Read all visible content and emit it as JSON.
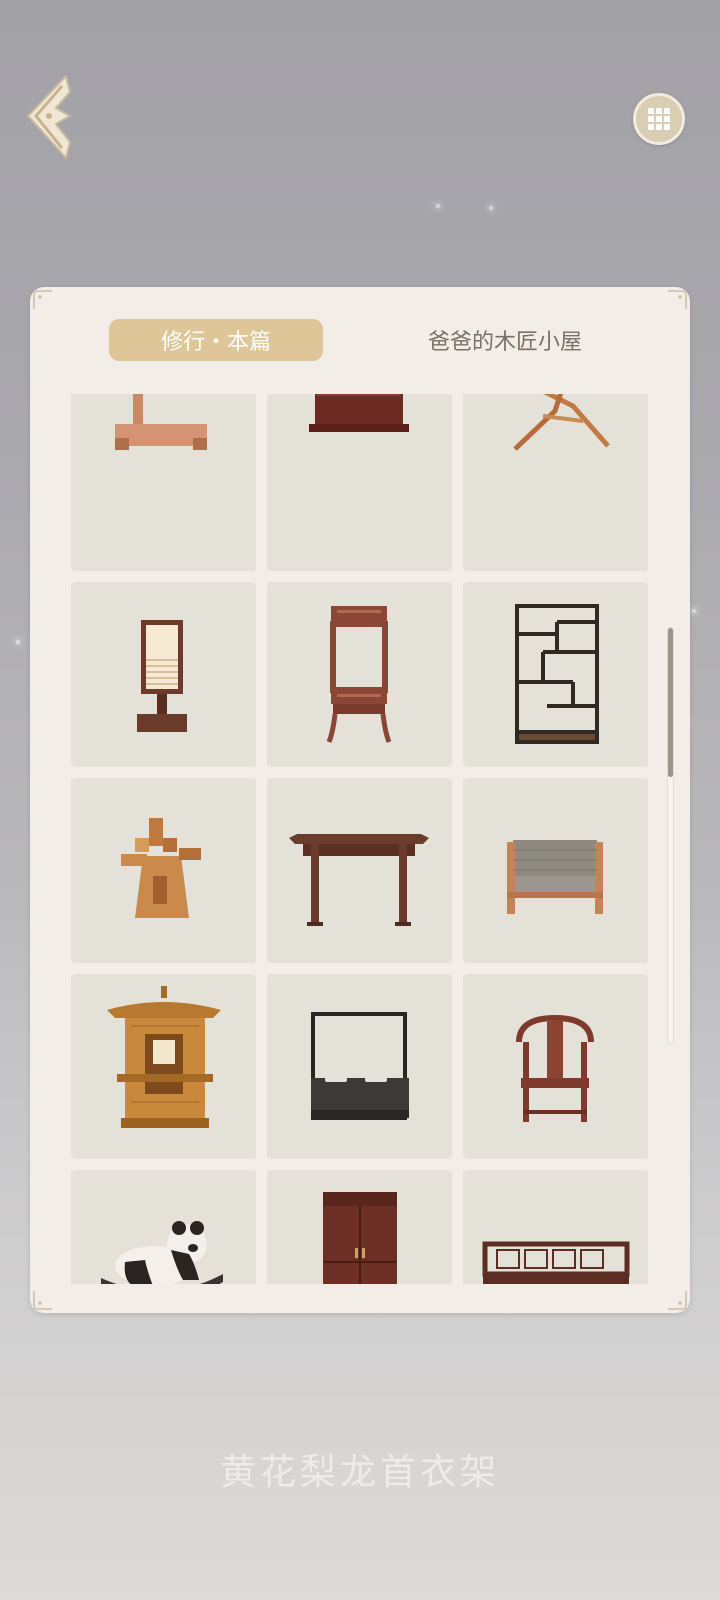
{
  "tabs": [
    {
      "label": "修行・本篇",
      "active": true
    },
    {
      "label": "爸爸的木匠小屋",
      "active": false
    }
  ],
  "items": [
    {
      "icon": "clothes-rack-stand-icon"
    },
    {
      "icon": "carved-cabinet-top-icon"
    },
    {
      "icon": "crossed-wood-stand-icon"
    },
    {
      "icon": "paper-lamp-icon"
    },
    {
      "icon": "carved-washstand-icon"
    },
    {
      "icon": "curio-shelf-icon"
    },
    {
      "icon": "windmill-icon"
    },
    {
      "icon": "altar-table-icon"
    },
    {
      "icon": "armchair-icon"
    },
    {
      "icon": "sedan-chair-icon"
    },
    {
      "icon": "canopy-bed-icon"
    },
    {
      "icon": "horseshoe-chair-icon"
    },
    {
      "icon": "panda-rocking-horse-icon"
    },
    {
      "icon": "wardrobe-icon"
    },
    {
      "icon": "luohan-bed-icon"
    }
  ],
  "caption": "黄花梨龙首衣架",
  "scroll": {
    "position_fraction": 0.0,
    "visible_fraction": 0.36
  },
  "colors": {
    "accent": "#dfc698",
    "panel": "#f2ede6",
    "cell": "#e4e2d8"
  }
}
